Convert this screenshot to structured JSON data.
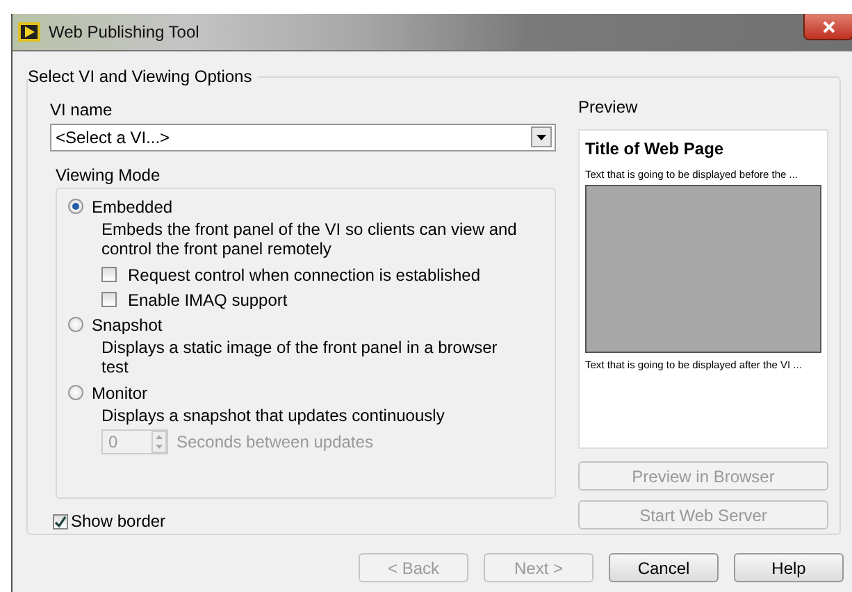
{
  "window": {
    "title": "Web Publishing Tool"
  },
  "group": {
    "title": "Select VI and Viewing Options"
  },
  "vi_name": {
    "label": "VI name",
    "value": "<Select a VI...>"
  },
  "viewing_mode": {
    "label": "Viewing Mode",
    "modes": [
      {
        "label": "Embedded",
        "selected": true,
        "description": "Embeds the front panel of the VI so clients can view and control the front panel remotely",
        "options": [
          {
            "label": "Request control when connection is established",
            "checked": false
          },
          {
            "label": "Enable IMAQ support",
            "checked": false
          }
        ]
      },
      {
        "label": "Snapshot",
        "selected": false,
        "description": "Displays a static image of the front panel in a browser test"
      },
      {
        "label": "Monitor",
        "selected": false,
        "description": "Displays a snapshot that updates continuously",
        "interval": {
          "value": "0",
          "label": "Seconds between updates",
          "disabled": true
        }
      }
    ]
  },
  "show_border": {
    "label": "Show border",
    "checked": true
  },
  "preview": {
    "label": "Preview",
    "title": "Title of Web Page",
    "before_text": "Text that is going to be displayed before the ...",
    "after_text": "Text that is going to be displayed after the VI ..."
  },
  "side_buttons": [
    {
      "label": "Preview in Browser",
      "disabled": true
    },
    {
      "label": "Start Web Server",
      "disabled": true
    }
  ],
  "footer_buttons": [
    {
      "label": "< Back",
      "disabled": true
    },
    {
      "label": "Next >",
      "disabled": true
    },
    {
      "label": "Cancel",
      "disabled": false
    },
    {
      "label": "Help",
      "disabled": false
    }
  ]
}
